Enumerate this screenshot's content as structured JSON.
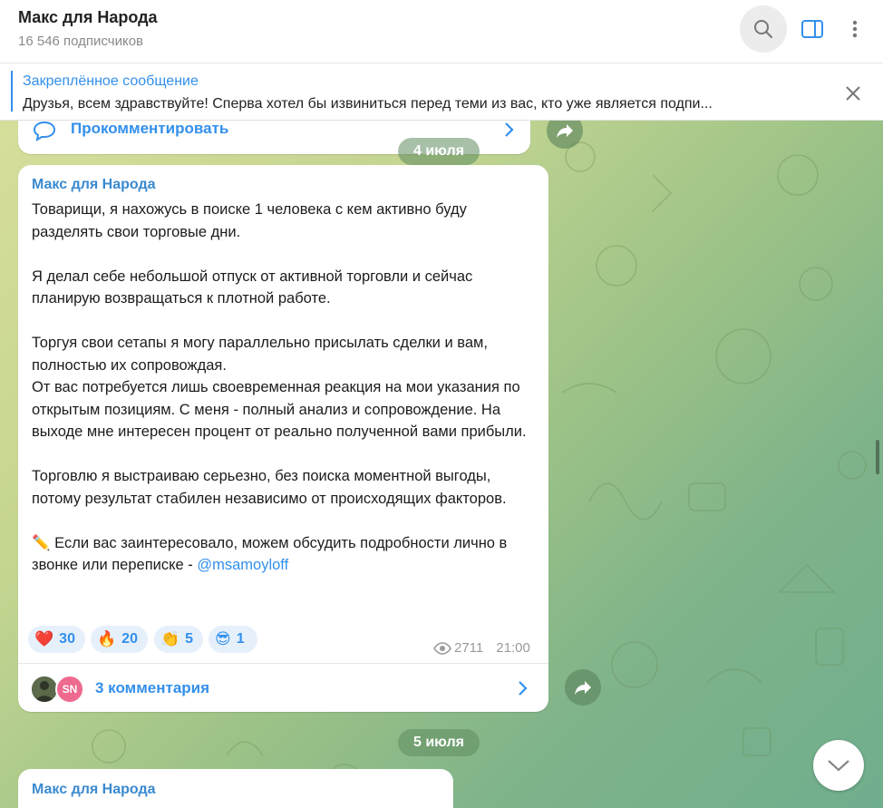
{
  "header": {
    "title": "Макс для Народа",
    "subscribers": "16 546 подписчиков",
    "icons": [
      "search-icon",
      "sidebar-toggle-icon",
      "more-vertical-icon"
    ]
  },
  "pinned": {
    "title": "Закреплённое сообщение",
    "text": "Друзья, всем здравствуйте!   Сперва хотел бы извиниться перед теми из вас, кто уже является подпи..."
  },
  "prev_message": {
    "comment_label": "Прокомментировать"
  },
  "dates": {
    "first": "4 июля",
    "second": "5 июля"
  },
  "message": {
    "author": "Макс для Народа",
    "paragraphs": [
      "Товарищи, я нахожусь в поиске 1 человека с кем активно буду разделять свои торговые дни.",
      "Я делал себе небольшой отпуск от активной торговли и сейчас планирую возвращаться к плотной работе.",
      "Торгуя свои сетапы я могу параллельно присылать сделки и вам, полностью их сопровождая.",
      "От вас потребуется лишь своевременная реакция на мои указания по открытым позициям. С меня - полный анализ и сопровождение. На выходе мне интересен процент от реально полученной вами прибыли.",
      "Торговлю я выстраиваю серьезно, без поиска моментной выгоды, потому результат стабилен независимо от происходящих факторов.",
      "✏️ Если вас заинтересовало, можем обсудить подробности лично в звонке или переписке - "
    ],
    "mention": "@msamoyloff",
    "reactions": [
      {
        "emoji": "❤️",
        "count": "30"
      },
      {
        "emoji": "🔥",
        "count": "20"
      },
      {
        "emoji": "👏",
        "count": "5"
      },
      {
        "emoji": "😎",
        "count": "1"
      }
    ],
    "views": "2711",
    "time": "21:00",
    "comments_label": "3 комментария",
    "avatar2_initials": "SN"
  },
  "next_message": {
    "author": "Макс для Народа"
  }
}
